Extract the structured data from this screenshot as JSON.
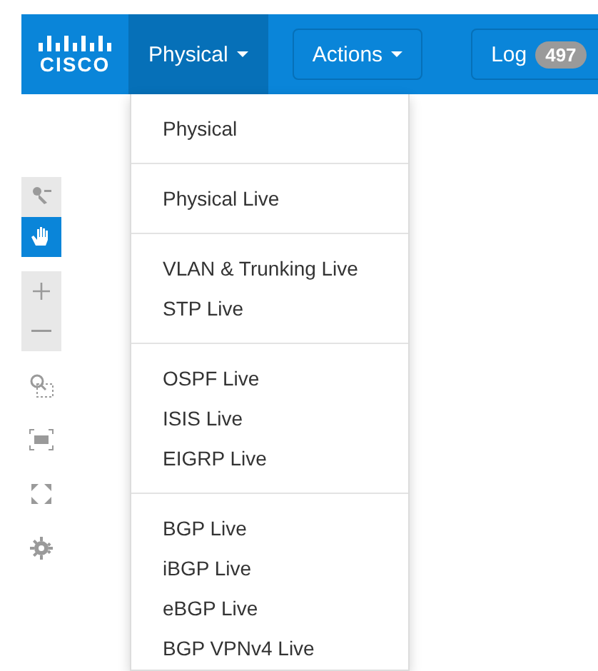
{
  "navbar": {
    "logo": "CISCO",
    "tabs": [
      {
        "label": "Physical",
        "caret": true,
        "selected": true
      },
      {
        "label": "Actions",
        "caret": true,
        "selected": false
      },
      {
        "label": "Log",
        "badge": "497",
        "selected": false
      }
    ]
  },
  "dropdown": {
    "groups": [
      [
        "Physical"
      ],
      [
        "Physical Live"
      ],
      [
        "VLAN & Trunking Live",
        "STP Live"
      ],
      [
        "OSPF Live",
        "ISIS Live",
        "EIGRP Live"
      ],
      [
        "BGP Live",
        "iBGP Live",
        "eBGP Live",
        "BGP VPNv4 Live"
      ]
    ]
  },
  "toolbar": {
    "groups": [
      {
        "boxed": true,
        "tools": [
          {
            "kind": "select",
            "selected": false
          },
          {
            "kind": "pan",
            "selected": true
          }
        ]
      },
      {
        "boxed": true,
        "tools": [
          {
            "kind": "zoom-in",
            "selected": false
          },
          {
            "kind": "zoom-out",
            "selected": false
          }
        ]
      },
      {
        "boxed": false,
        "tools": [
          {
            "kind": "zoom-region",
            "selected": false
          }
        ]
      },
      {
        "boxed": false,
        "tools": [
          {
            "kind": "fit",
            "selected": false
          }
        ]
      },
      {
        "boxed": false,
        "tools": [
          {
            "kind": "expand",
            "selected": false
          }
        ]
      },
      {
        "boxed": false,
        "tools": [
          {
            "kind": "settings",
            "selected": false
          }
        ]
      }
    ]
  }
}
